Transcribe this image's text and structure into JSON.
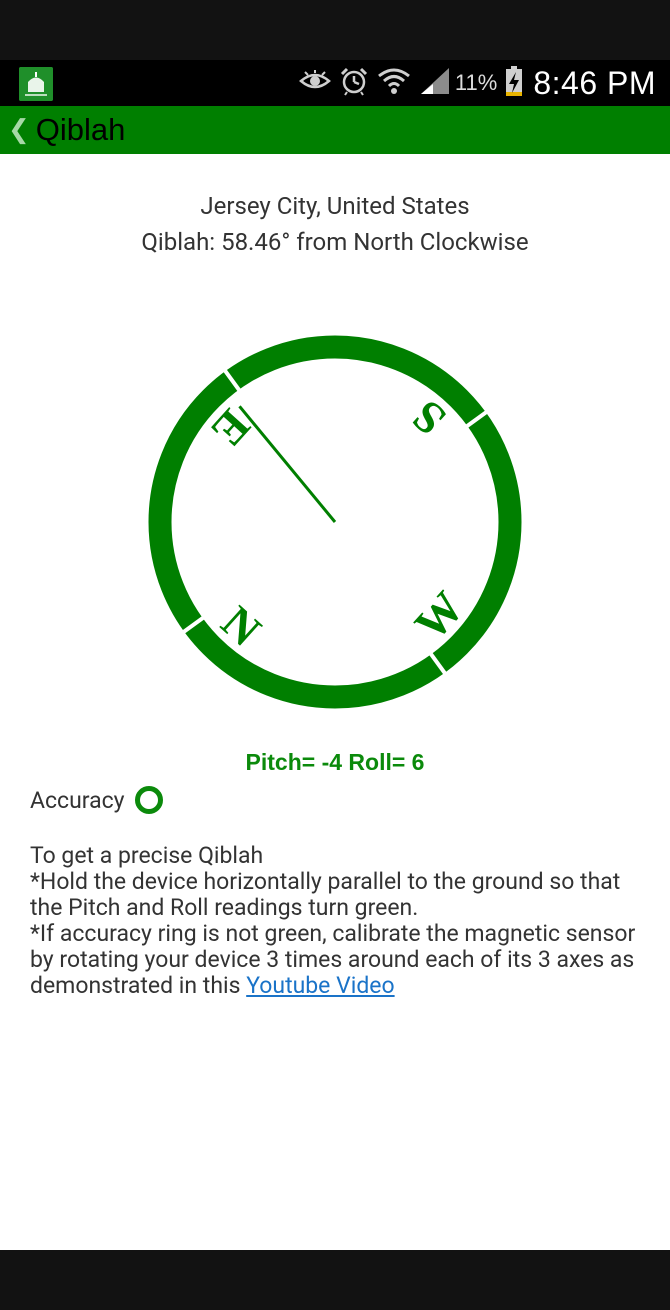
{
  "status_bar": {
    "battery_percent": "11%",
    "time": "8:46 PM",
    "icons": [
      "app-notification-icon",
      "eye-icon",
      "alarm-icon",
      "wifi-icon",
      "signal-icon",
      "battery-charging-icon"
    ]
  },
  "action_bar": {
    "back_icon": "chevron-left-icon",
    "title": "Qiblah"
  },
  "location": {
    "city": "Jersey City, United States",
    "qiblah": "Qiblah: 58.46° from North Clockwise"
  },
  "compass": {
    "qiblah_degrees": 58.46,
    "ring_color": "#007f00",
    "labels": {
      "north": "N",
      "east": "E",
      "south": "S",
      "west": "W"
    }
  },
  "readings": {
    "pitch_roll": "Pitch= -4 Roll= 6",
    "accuracy_label": "Accuracy",
    "accuracy_color": "#0b8a0b"
  },
  "instructions": {
    "line1": "To get a precise Qiblah",
    "line2": "*Hold the device horizontally parallel to the ground so that the Pitch and Roll readings turn green.",
    "line3": "*If accuracy ring is not green, calibrate the magnetic sensor by rotating your device 3 times around each of its 3 axes as demonstrated in this",
    "link_text": "Youtube Video"
  },
  "colors": {
    "action_bar": "#007f00",
    "link": "#1a73c8",
    "status_bar": "#000000"
  }
}
